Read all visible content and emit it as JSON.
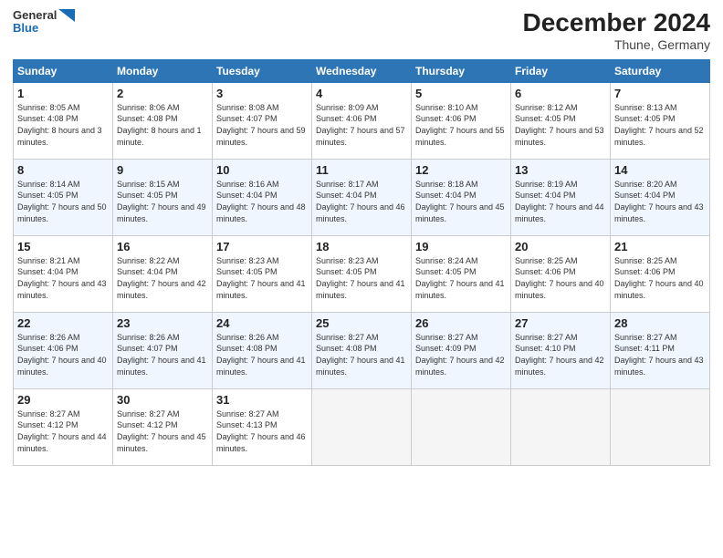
{
  "header": {
    "logo_line1": "General",
    "logo_line2": "Blue",
    "month_title": "December 2024",
    "location": "Thune, Germany"
  },
  "days_of_week": [
    "Sunday",
    "Monday",
    "Tuesday",
    "Wednesday",
    "Thursday",
    "Friday",
    "Saturday"
  ],
  "weeks": [
    [
      {
        "day": "1",
        "sunrise": "Sunrise: 8:05 AM",
        "sunset": "Sunset: 4:08 PM",
        "daylight": "Daylight: 8 hours and 3 minutes."
      },
      {
        "day": "2",
        "sunrise": "Sunrise: 8:06 AM",
        "sunset": "Sunset: 4:08 PM",
        "daylight": "Daylight: 8 hours and 1 minute."
      },
      {
        "day": "3",
        "sunrise": "Sunrise: 8:08 AM",
        "sunset": "Sunset: 4:07 PM",
        "daylight": "Daylight: 7 hours and 59 minutes."
      },
      {
        "day": "4",
        "sunrise": "Sunrise: 8:09 AM",
        "sunset": "Sunset: 4:06 PM",
        "daylight": "Daylight: 7 hours and 57 minutes."
      },
      {
        "day": "5",
        "sunrise": "Sunrise: 8:10 AM",
        "sunset": "Sunset: 4:06 PM",
        "daylight": "Daylight: 7 hours and 55 minutes."
      },
      {
        "day": "6",
        "sunrise": "Sunrise: 8:12 AM",
        "sunset": "Sunset: 4:05 PM",
        "daylight": "Daylight: 7 hours and 53 minutes."
      },
      {
        "day": "7",
        "sunrise": "Sunrise: 8:13 AM",
        "sunset": "Sunset: 4:05 PM",
        "daylight": "Daylight: 7 hours and 52 minutes."
      }
    ],
    [
      {
        "day": "8",
        "sunrise": "Sunrise: 8:14 AM",
        "sunset": "Sunset: 4:05 PM",
        "daylight": "Daylight: 7 hours and 50 minutes."
      },
      {
        "day": "9",
        "sunrise": "Sunrise: 8:15 AM",
        "sunset": "Sunset: 4:05 PM",
        "daylight": "Daylight: 7 hours and 49 minutes."
      },
      {
        "day": "10",
        "sunrise": "Sunrise: 8:16 AM",
        "sunset": "Sunset: 4:04 PM",
        "daylight": "Daylight: 7 hours and 48 minutes."
      },
      {
        "day": "11",
        "sunrise": "Sunrise: 8:17 AM",
        "sunset": "Sunset: 4:04 PM",
        "daylight": "Daylight: 7 hours and 46 minutes."
      },
      {
        "day": "12",
        "sunrise": "Sunrise: 8:18 AM",
        "sunset": "Sunset: 4:04 PM",
        "daylight": "Daylight: 7 hours and 45 minutes."
      },
      {
        "day": "13",
        "sunrise": "Sunrise: 8:19 AM",
        "sunset": "Sunset: 4:04 PM",
        "daylight": "Daylight: 7 hours and 44 minutes."
      },
      {
        "day": "14",
        "sunrise": "Sunrise: 8:20 AM",
        "sunset": "Sunset: 4:04 PM",
        "daylight": "Daylight: 7 hours and 43 minutes."
      }
    ],
    [
      {
        "day": "15",
        "sunrise": "Sunrise: 8:21 AM",
        "sunset": "Sunset: 4:04 PM",
        "daylight": "Daylight: 7 hours and 43 minutes."
      },
      {
        "day": "16",
        "sunrise": "Sunrise: 8:22 AM",
        "sunset": "Sunset: 4:04 PM",
        "daylight": "Daylight: 7 hours and 42 minutes."
      },
      {
        "day": "17",
        "sunrise": "Sunrise: 8:23 AM",
        "sunset": "Sunset: 4:05 PM",
        "daylight": "Daylight: 7 hours and 41 minutes."
      },
      {
        "day": "18",
        "sunrise": "Sunrise: 8:23 AM",
        "sunset": "Sunset: 4:05 PM",
        "daylight": "Daylight: 7 hours and 41 minutes."
      },
      {
        "day": "19",
        "sunrise": "Sunrise: 8:24 AM",
        "sunset": "Sunset: 4:05 PM",
        "daylight": "Daylight: 7 hours and 41 minutes."
      },
      {
        "day": "20",
        "sunrise": "Sunrise: 8:25 AM",
        "sunset": "Sunset: 4:06 PM",
        "daylight": "Daylight: 7 hours and 40 minutes."
      },
      {
        "day": "21",
        "sunrise": "Sunrise: 8:25 AM",
        "sunset": "Sunset: 4:06 PM",
        "daylight": "Daylight: 7 hours and 40 minutes."
      }
    ],
    [
      {
        "day": "22",
        "sunrise": "Sunrise: 8:26 AM",
        "sunset": "Sunset: 4:06 PM",
        "daylight": "Daylight: 7 hours and 40 minutes."
      },
      {
        "day": "23",
        "sunrise": "Sunrise: 8:26 AM",
        "sunset": "Sunset: 4:07 PM",
        "daylight": "Daylight: 7 hours and 41 minutes."
      },
      {
        "day": "24",
        "sunrise": "Sunrise: 8:26 AM",
        "sunset": "Sunset: 4:08 PM",
        "daylight": "Daylight: 7 hours and 41 minutes."
      },
      {
        "day": "25",
        "sunrise": "Sunrise: 8:27 AM",
        "sunset": "Sunset: 4:08 PM",
        "daylight": "Daylight: 7 hours and 41 minutes."
      },
      {
        "day": "26",
        "sunrise": "Sunrise: 8:27 AM",
        "sunset": "Sunset: 4:09 PM",
        "daylight": "Daylight: 7 hours and 42 minutes."
      },
      {
        "day": "27",
        "sunrise": "Sunrise: 8:27 AM",
        "sunset": "Sunset: 4:10 PM",
        "daylight": "Daylight: 7 hours and 42 minutes."
      },
      {
        "day": "28",
        "sunrise": "Sunrise: 8:27 AM",
        "sunset": "Sunset: 4:11 PM",
        "daylight": "Daylight: 7 hours and 43 minutes."
      }
    ],
    [
      {
        "day": "29",
        "sunrise": "Sunrise: 8:27 AM",
        "sunset": "Sunset: 4:12 PM",
        "daylight": "Daylight: 7 hours and 44 minutes."
      },
      {
        "day": "30",
        "sunrise": "Sunrise: 8:27 AM",
        "sunset": "Sunset: 4:12 PM",
        "daylight": "Daylight: 7 hours and 45 minutes."
      },
      {
        "day": "31",
        "sunrise": "Sunrise: 8:27 AM",
        "sunset": "Sunset: 4:13 PM",
        "daylight": "Daylight: 7 hours and 46 minutes."
      },
      null,
      null,
      null,
      null
    ]
  ]
}
